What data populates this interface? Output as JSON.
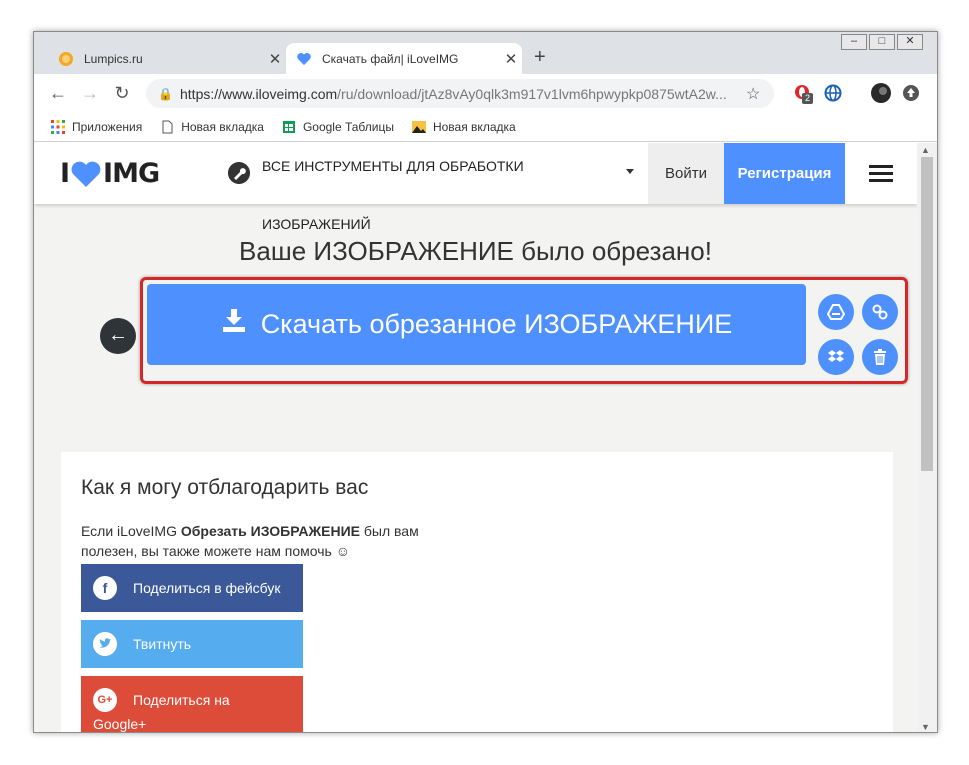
{
  "browser": {
    "tabs": [
      {
        "title": "Lumpics.ru",
        "close": "✕"
      },
      {
        "title": "Скачать файл| iLoveIMG",
        "close": "✕"
      }
    ],
    "new_tab": "+",
    "window_buttons": [
      "–",
      "□",
      "✕"
    ],
    "url_main": "https://www.iloveimg.com",
    "url_path": "/ru/download/jtAz8vAy0qlk3m917v1lvm6hpwypkp0875wtA2w...",
    "extension_badge": "2",
    "bookmarks": [
      {
        "label": "Приложения",
        "icon": "apps-grid-icon"
      },
      {
        "label": "Новая вкладка",
        "icon": "page-icon"
      },
      {
        "label": "Google Таблицы",
        "icon": "sheets-icon"
      },
      {
        "label": "Новая вкладка",
        "icon": "image-icon"
      }
    ]
  },
  "site": {
    "logo_left": "I",
    "logo_right": "IMG",
    "all_tools_line1": "ВСЕ ИНСТРУМЕНТЫ ДЛЯ ОБРАБОТКИ",
    "all_tools_line2": "ИЗОБРАЖЕНИЙ",
    "login": "Войти",
    "register": "Регистрация"
  },
  "main": {
    "title": "Ваше ИЗОБРАЖЕНИЕ было обрезано!",
    "download_label": "Скачать обрезанное ИЗОБРАЖЕНИЕ"
  },
  "thanks": {
    "heading": "Как я могу отблагодарить вас",
    "text_before": "Если iLoveIMG ",
    "text_bold": "Обрезать ИЗОБРАЖЕНИЕ",
    "text_after": " был вам полезен, вы также можете нам помочь ☺",
    "share_facebook": "Поделиться в фейсбук",
    "share_twitter": "Твитнуть",
    "share_google_line1": "Поделиться на",
    "share_google_line2": "Google+"
  },
  "colors": {
    "accent": "#4d90fe",
    "facebook": "#3b5998",
    "twitter": "#55acee",
    "google": "#dd4b39",
    "linkedin": "#0e76a8",
    "highlight": "#d62728"
  }
}
